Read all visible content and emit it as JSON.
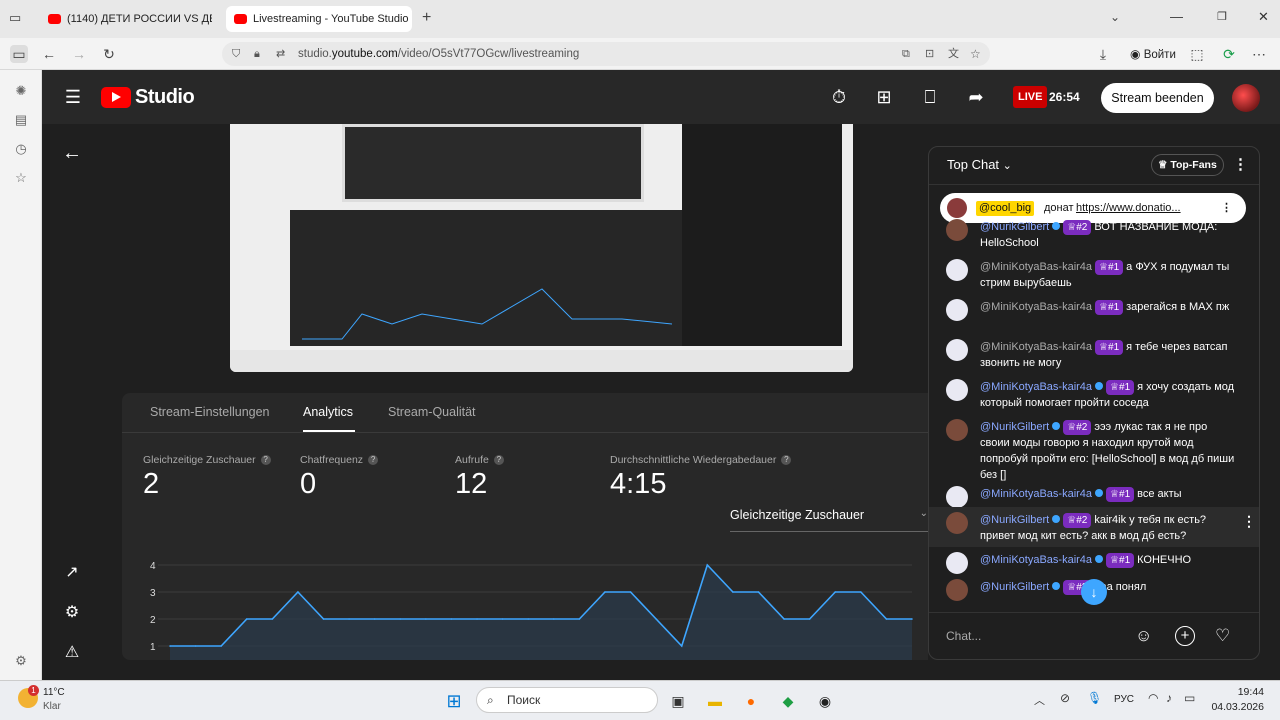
{
  "browser": {
    "tabs": [
      {
        "label": "(1140) ДЕТИ РОССИИ VS ДЕТИ"
      },
      {
        "label": "Livestreaming - YouTube Studio"
      }
    ],
    "url_host": "studio.",
    "url_domain": "youtube.com",
    "url_path": "/video/O5sVt77OGcw/livestreaming",
    "login_label": "Войти"
  },
  "studio": {
    "logo": "Studio",
    "live_label": "LIVE",
    "live_time": "26:54",
    "end_stream_label": "Stream beenden"
  },
  "analytics": {
    "tabs": [
      "Stream-Einstellungen",
      "Analytics",
      "Stream-Qualität"
    ],
    "stats": [
      {
        "label": "Gleichzeitige Zuschauer",
        "value": "2"
      },
      {
        "label": "Chatfrequenz",
        "value": "0"
      },
      {
        "label": "Aufrufe",
        "value": "12"
      },
      {
        "label": "Durchschnittliche Wiedergabedauer",
        "value": "4:15"
      }
    ],
    "metric_select": "Gleichzeitige Zuschauer"
  },
  "chart_data": {
    "type": "area",
    "title": "",
    "xlabel": "",
    "ylabel": "",
    "ylim": [
      1,
      4
    ],
    "y_ticks": [
      "4",
      "3",
      "2",
      "1"
    ],
    "values": [
      1,
      1,
      1,
      2,
      2,
      3,
      2,
      2,
      2,
      2,
      2,
      2,
      2,
      2,
      2,
      2,
      2,
      3,
      3,
      2,
      1,
      4,
      3,
      3,
      2,
      2,
      3,
      3,
      2,
      2
    ],
    "color": "#3ea6ff"
  },
  "chat": {
    "title": "Top Chat",
    "topfans_label": "Top-Fans",
    "pinned": {
      "user": "@cool_big",
      "text": "донат",
      "link": "https://www.donatio..."
    },
    "messages": [
      {
        "author": "@NurikGilbert",
        "badge": "#2",
        "text": "ВОТ НАЗВАНИЕ МОДА: HelloSchool"
      },
      {
        "author": "@MiniKotyaBas-kair4a",
        "badge": "#1",
        "text": "а ФУХ я подумал ты стрим вырубаешь"
      },
      {
        "author": "@MiniKotyaBas-kair4a",
        "badge": "#1",
        "text": "зарегайся в MAX пж"
      },
      {
        "author": "@MiniKotyaBas-kair4a",
        "badge": "#1",
        "text": "я тебе через ватсап звонить не могу"
      },
      {
        "author": "@MiniKotyaBas-kair4a",
        "badge": "#1",
        "text": "я хочу создать мод который помогает пройти соседа"
      },
      {
        "author": "@NurikGilbert",
        "badge": "#2",
        "text": "эээ лукас так я не про своии моды говорю я находил крутой мод попробуй пройти его: [HelloSchool] в мод дб пиши без []"
      },
      {
        "author": "@MiniKotyaBas-kair4a",
        "badge": "#1",
        "text": "все акты"
      },
      {
        "author": "@NurikGilbert",
        "badge": "#2",
        "text": "kair4ik у тебя пк есть? привет мод кит есть? акк в мод дб есть?"
      },
      {
        "author": "@MiniKotyaBas-kair4a",
        "badge": "#1",
        "text": "КОНЕЧНО"
      },
      {
        "author": "@NurikGilbert",
        "badge": "#2",
        "text": "ааа понял"
      }
    ],
    "input_placeholder": "Chat..."
  },
  "taskbar": {
    "weather_temp": "11°C",
    "weather_desc": "Klar",
    "search_label": "Поиск",
    "lang": "РУС",
    "time": "19:44",
    "date": "04.03.2026"
  }
}
